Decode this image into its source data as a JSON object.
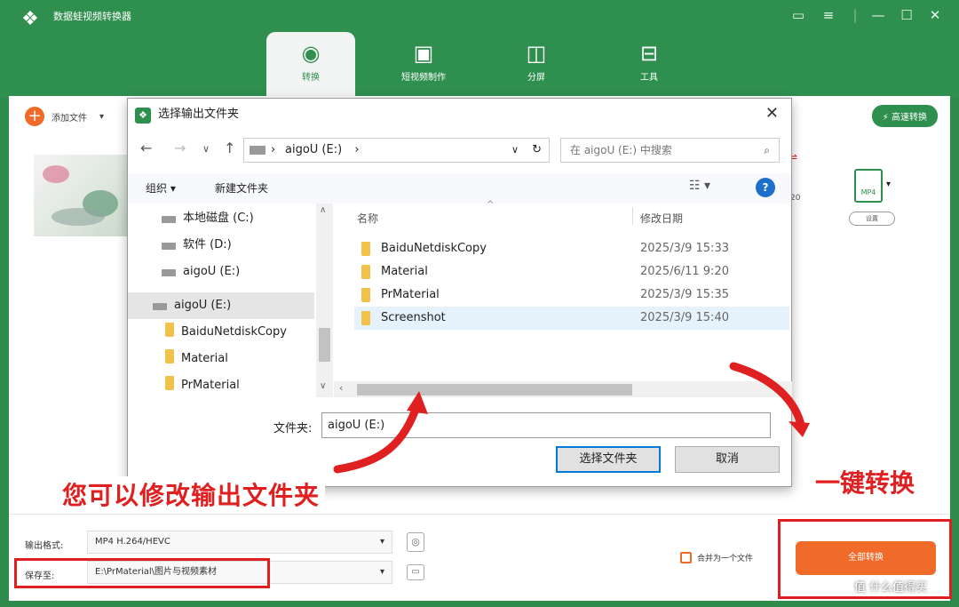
{
  "app": {
    "title": "数据蛙视频转换器",
    "nav": [
      {
        "label": "转换",
        "icon": "convert-icon"
      },
      {
        "label": "短视频制作",
        "icon": "tv-icon"
      },
      {
        "label": "分屏",
        "icon": "split-screen-icon"
      },
      {
        "label": "工具",
        "icon": "toolbox-icon"
      }
    ],
    "window_controls": [
      "feedback",
      "menu",
      "minimize",
      "maximize",
      "close"
    ]
  },
  "toolbar": {
    "add_label": "添加文件",
    "speed_label": "高速转换"
  },
  "file_item": {
    "format_badge": "MP4",
    "format_select": "设置",
    "partial_text": "20"
  },
  "bottom": {
    "format_label": "输出格式:",
    "format_value": "MP4 H.264/HEVC",
    "save_label": "保存至:",
    "save_value": "E:\\PrMaterial\\图片与视频素材",
    "merge_label": "合并为一个文件",
    "convert_label": "全部转换"
  },
  "dialog": {
    "title": "选择输出文件夹",
    "address": "aigoU (E:)",
    "search_placeholder": "在 aigoU (E:) 中搜索",
    "organize": "组织 ▾",
    "new_folder": "新建文件夹",
    "nav_items": [
      "本地磁盘 (C:)",
      "软件 (D:)",
      "aigoU (E:)",
      "aigoU (E:)",
      "BaiduNetdiskCopy",
      "Material",
      "PrMaterial"
    ],
    "columns": [
      "名称",
      "修改日期"
    ],
    "files": [
      {
        "name": "BaiduNetdiskCopy",
        "date": "2025/3/9 15:33"
      },
      {
        "name": "Material",
        "date": "2025/6/11 9:20"
      },
      {
        "name": "PrMaterial",
        "date": "2025/3/9 15:35"
      },
      {
        "name": "Screenshot",
        "date": "2025/3/9 15:40"
      }
    ],
    "folder_label": "文件夹:",
    "folder_value": "aigoU (E:)",
    "select_btn": "选择文件夹",
    "cancel_btn": "取消"
  },
  "annotations": {
    "left": "您可以修改输出文件夹",
    "right": "一键转换",
    "watermark": "值 什么值得买"
  },
  "colors": {
    "brand": "#2f8f4f",
    "accent": "#f06a2a",
    "annotation": "#e02020"
  }
}
